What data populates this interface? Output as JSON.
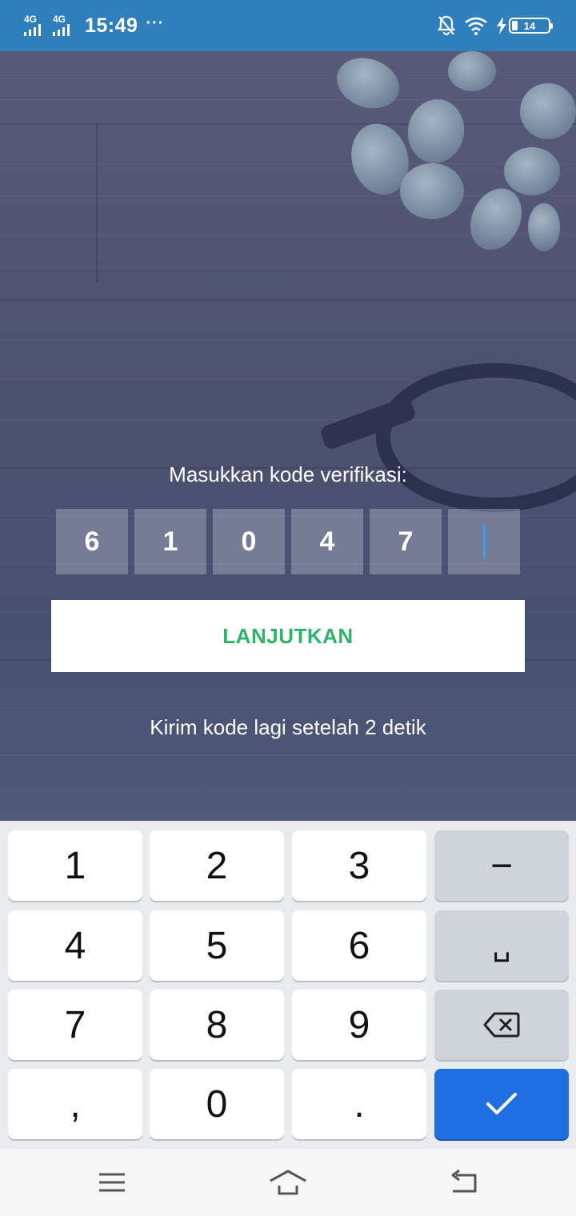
{
  "status_bar": {
    "network_1": "4G",
    "network_2": "4G",
    "time": "15:49",
    "more": "···",
    "battery_level": "14",
    "icons": [
      "signal-icon",
      "signal-icon",
      "mute-bell-icon",
      "wifi-icon",
      "charging-bolt-icon",
      "battery-icon"
    ]
  },
  "verification": {
    "prompt": "Masukkan kode verifikasi:",
    "digits": [
      "6",
      "1",
      "0",
      "4",
      "7",
      ""
    ],
    "continue_label": "LANJUTKAN",
    "resend_text": "Kirim kode lagi setelah 2 detik"
  },
  "keyboard": {
    "keys": [
      "1",
      "2",
      "3",
      "−",
      "4",
      "5",
      "6",
      "␣",
      "7",
      "8",
      "9",
      "⌫",
      ",",
      "0",
      ".",
      "✓"
    ],
    "accent_color": "#1f6fe3"
  },
  "navbar": {
    "icons": [
      "menu-icon",
      "home-icon",
      "back-icon"
    ]
  },
  "colors": {
    "status_bar": "#2f7fbd",
    "button_text": "#2fb36b",
    "cursor": "#3aa0f0"
  }
}
